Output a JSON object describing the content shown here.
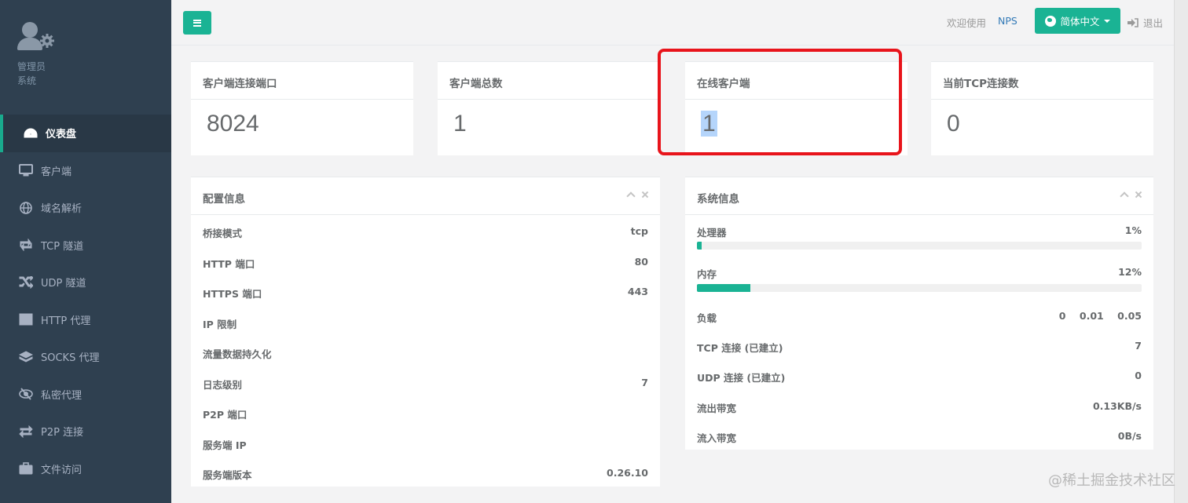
{
  "sidebar": {
    "profile": {
      "role": "管理员",
      "label": "系统"
    },
    "items": [
      {
        "label": "仪表盘",
        "icon": "dashboard-icon"
      },
      {
        "label": "客户端",
        "icon": "desktop-icon"
      },
      {
        "label": "域名解析",
        "icon": "globe-icon"
      },
      {
        "label": "TCP 隧道",
        "icon": "retweet-icon"
      },
      {
        "label": "UDP 隧道",
        "icon": "random-icon"
      },
      {
        "label": "HTTP 代理",
        "icon": "server-icon"
      },
      {
        "label": "SOCKS 代理",
        "icon": "layers-icon"
      },
      {
        "label": "私密代理",
        "icon": "eye-slash-icon"
      },
      {
        "label": "P2P 连接",
        "icon": "exchange-icon"
      },
      {
        "label": "文件访问",
        "icon": "briefcase-icon"
      }
    ]
  },
  "topbar": {
    "welcome": "欢迎使用",
    "brand": "NPS",
    "language": "简体中文",
    "logout": "退出"
  },
  "stats": [
    {
      "title": "客户端连接端口",
      "value": "8024"
    },
    {
      "title": "客户端总数",
      "value": "1"
    },
    {
      "title": "在线客户端",
      "value": "1"
    },
    {
      "title": "当前TCP连接数",
      "value": "0"
    }
  ],
  "config_panel": {
    "title": "配置信息",
    "rows": [
      {
        "key": "桥接模式",
        "value": "tcp"
      },
      {
        "key": "HTTP 端口",
        "value": "80"
      },
      {
        "key": "HTTPS 端口",
        "value": "443"
      },
      {
        "key": "IP 限制",
        "value": ""
      },
      {
        "key": "流量数据持久化",
        "value": ""
      },
      {
        "key": "日志级别",
        "value": "7"
      },
      {
        "key": "P2P 端口",
        "value": ""
      },
      {
        "key": "服务端 IP",
        "value": ""
      },
      {
        "key": "服务端版本",
        "value": "0.26.10"
      }
    ]
  },
  "system_panel": {
    "title": "系统信息",
    "cpu": {
      "key": "处理器",
      "value": "1%",
      "percent": 1
    },
    "memory": {
      "key": "内存",
      "value": "12%",
      "percent": 12
    },
    "load": {
      "key": "负载",
      "values": [
        "0",
        "0.01",
        "0.05"
      ]
    },
    "rows": [
      {
        "key": "TCP 连接 (已建立)",
        "value": "7"
      },
      {
        "key": "UDP 连接 (已建立)",
        "value": "0"
      },
      {
        "key": "流出带宽",
        "value": "0.13KB/s"
      },
      {
        "key": "流入带宽",
        "value": "0B/s"
      }
    ]
  },
  "watermark": "@稀土掘金技术社区",
  "colors": {
    "accent": "#1ab394",
    "sidebar": "#2f4050",
    "highlight": "#e8141b"
  }
}
